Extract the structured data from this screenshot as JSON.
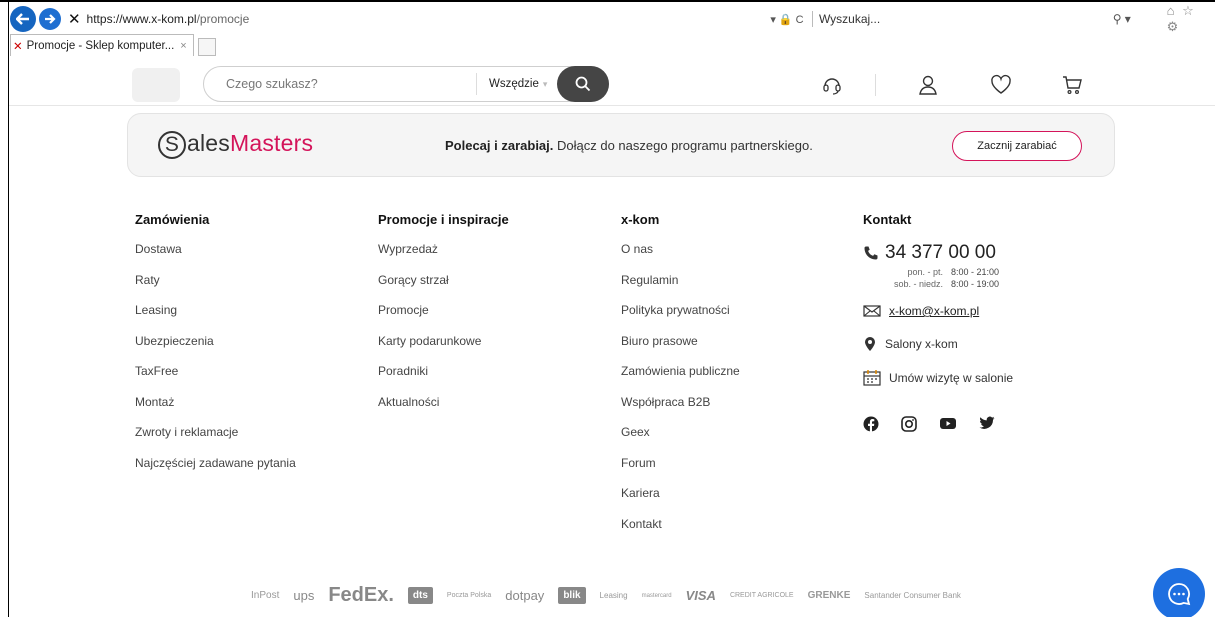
{
  "browser": {
    "url_host": "https://www.x-kom.pl",
    "url_path": "/promocje",
    "search_placeholder": "Wyszukaj...",
    "tab_title": "Promocje - Sklep komputer...",
    "tab_close": "×",
    "addr_tools": "▾ 🔒 C",
    "search_tools": "⚲ ▾",
    "right_icons": "⌂ ☆ ⚙"
  },
  "header": {
    "search_placeholder": "Czego szukasz?",
    "scope": "Wszędzie"
  },
  "banner": {
    "logo_sales": "ales",
    "logo_masters": "Masters",
    "logo_dollar": "S",
    "text_bold": "Polecaj i zarabiaj.",
    "text_rest": " Dołącz do naszego programu partnerskiego.",
    "button": "Zacznij zarabiać"
  },
  "footer": {
    "orders": {
      "title": "Zamówienia",
      "items": [
        "Dostawa",
        "Raty",
        "Leasing",
        "Ubezpieczenia",
        "TaxFree",
        "Montaż",
        "Zwroty i reklamacje",
        "Najczęściej zadawane pytania"
      ]
    },
    "promos": {
      "title": "Promocje i inspiracje",
      "items": [
        "Wyprzedaż",
        "Gorący strzał",
        "Promocje",
        "Karty podarunkowe",
        "Poradniki",
        "Aktualności"
      ]
    },
    "xkom": {
      "title": "x-kom",
      "items": [
        "O nas",
        "Regulamin",
        "Polityka prywatności",
        "Biuro prasowe",
        "Zamówienia publiczne",
        "Współpraca B2B",
        "Geex",
        "Forum",
        "Kariera",
        "Kontakt"
      ]
    },
    "contact": {
      "title": "Kontakt",
      "phone": "34 377 00 00",
      "hours_wd_label": "pon. - pt.",
      "hours_wd": "8:00 - 21:00",
      "hours_we_label": "sob. - niedz.",
      "hours_we": "8:00 - 19:00",
      "email": "x-kom@x-kom.pl",
      "stores": "Salony x-kom",
      "appointment": "Umów wizytę w salonie"
    }
  },
  "payments": [
    "InPost",
    "ups",
    "FedEx.",
    "dts",
    "Poczta Polska",
    "dotpay",
    "blik",
    "Leasing",
    "mastercard",
    "VISA",
    "CREDIT AGRICOLE",
    "GRENKE",
    "Santander Consumer Bank"
  ],
  "colors": {
    "accent": "#d4145a",
    "chat": "#1e6fe0",
    "search_btn": "#454545"
  }
}
